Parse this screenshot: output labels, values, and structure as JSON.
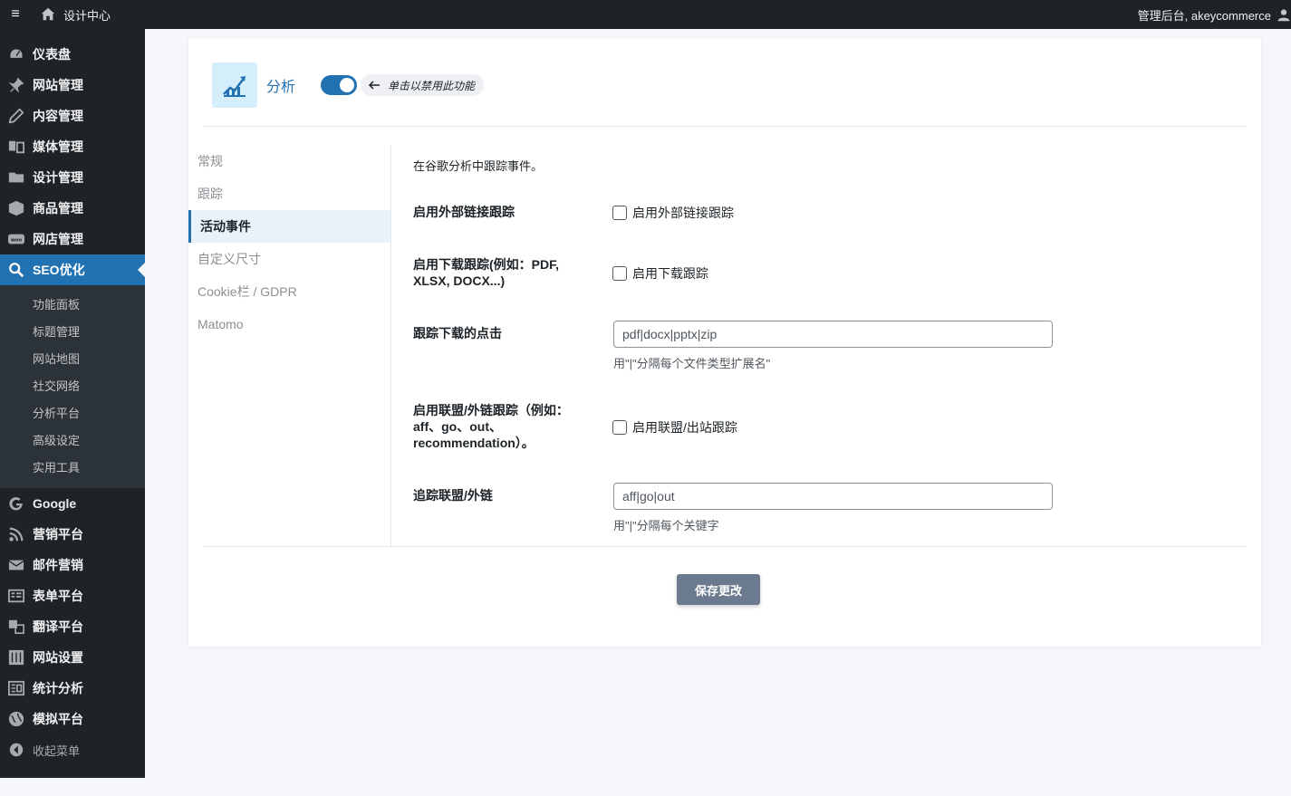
{
  "adminbar": {
    "site_title": "设计中心",
    "account": "管理后台, akeycommerce"
  },
  "sidebar": {
    "items": [
      {
        "label": "仪表盘",
        "icon": "dashboard-icon"
      },
      {
        "label": "网站管理",
        "icon": "pin-icon"
      },
      {
        "label": "内容管理",
        "icon": "pencil-icon"
      },
      {
        "label": "媒体管理",
        "icon": "media-icon"
      },
      {
        "label": "设计管理",
        "icon": "folder-icon"
      },
      {
        "label": "商品管理",
        "icon": "box-icon"
      },
      {
        "label": "网店管理",
        "icon": "woo-icon"
      },
      {
        "label": "SEO优化",
        "icon": "search-icon"
      }
    ],
    "submenu": [
      "功能面板",
      "标题管理",
      "网站地图",
      "社交网络",
      "分析平台",
      "高级设定",
      "实用工具"
    ],
    "items_after": [
      {
        "label": "Google",
        "icon": "google-icon"
      },
      {
        "label": "营销平台",
        "icon": "rss-icon"
      },
      {
        "label": "邮件营销",
        "icon": "mail-icon"
      },
      {
        "label": "表单平台",
        "icon": "form-icon"
      },
      {
        "label": "翻译平台",
        "icon": "translate-icon"
      },
      {
        "label": "网站设置",
        "icon": "settings-icon"
      },
      {
        "label": "统计分析",
        "icon": "chart-icon"
      },
      {
        "label": "模拟平台",
        "icon": "globe-icon"
      }
    ],
    "collapse_label": "收起菜单"
  },
  "module": {
    "title": "分析",
    "toggle_hint": "单击以禁用此功能",
    "toggle_on": true
  },
  "subnav": [
    "常规",
    "跟踪",
    "活动事件",
    "自定义尺寸",
    "Cookie栏 / GDPR",
    "Matomo"
  ],
  "subnav_active": 2,
  "form": {
    "description": "在谷歌分析中跟踪事件。",
    "external_label": "启用外部链接跟踪",
    "external_cb": "启用外部链接跟踪",
    "download_label_1": "启用下载跟踪(例如：PDF,",
    "download_label_2": "XLSX, DOCX...)",
    "download_cb": "启用下载跟踪",
    "download_clicks_label": "跟踪下载的点击",
    "download_clicks_value": "pdf|docx|pptx|zip",
    "download_clicks_help": "用\"|\"分隔每个文件类型扩展名\"",
    "affiliate_label_1": "启用联盟/外链跟踪（例如：",
    "affiliate_label_2": "aff、go、out、",
    "affiliate_label_3": "recommendation）。",
    "affiliate_cb": "启用联盟/出站跟踪",
    "affiliate_track_label": "追踪联盟/外链",
    "affiliate_track_value": "aff|go|out",
    "affiliate_track_help": "用\"|\"分隔每个关键字"
  },
  "save_label": "保存更改",
  "colors": {
    "accent": "#2271b1",
    "sidebar_bg": "#1d2327",
    "save_bg": "#6b7a8f"
  }
}
